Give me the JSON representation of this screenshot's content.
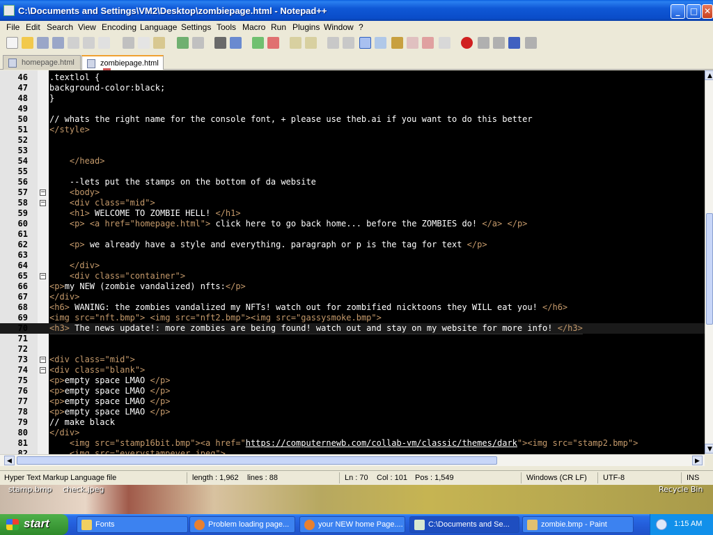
{
  "window": {
    "title": "C:\\Documents and Settings\\VM2\\Desktop\\zombiepage.html - Notepad++",
    "minimize": "_",
    "maximize": "□",
    "close": "✕"
  },
  "menu": [
    "File",
    "Edit",
    "Search",
    "View",
    "Encoding",
    "Language",
    "Settings",
    "Tools",
    "Macro",
    "Run",
    "Plugins",
    "Window",
    "?"
  ],
  "tabs": [
    {
      "label": "homepage.html",
      "active": false
    },
    {
      "label": "zombiepage.html",
      "active": true
    }
  ],
  "editor": {
    "current_line": 70,
    "lines": [
      {
        "n": "46",
        "text": ".textlol {"
      },
      {
        "n": "47",
        "text": "background-color:black;"
      },
      {
        "n": "48",
        "text": "}"
      },
      {
        "n": "49",
        "text": ""
      },
      {
        "n": "50",
        "text": "// whats the right name for the console font, + please use theb.ai if you want to do this better"
      },
      {
        "n": "51",
        "text": "</style>"
      },
      {
        "n": "52",
        "text": ""
      },
      {
        "n": "53",
        "text": ""
      },
      {
        "n": "54",
        "text": "    </head>"
      },
      {
        "n": "55",
        "text": ""
      },
      {
        "n": "56",
        "text": "    --lets put the stamps on the bottom of da website"
      },
      {
        "n": "57",
        "text": "    <body>"
      },
      {
        "n": "58",
        "text": "    <div class=\"mid\">"
      },
      {
        "n": "59",
        "text": "    <h1> WELCOME TO ZOMBIE HELL! </h1>"
      },
      {
        "n": "60",
        "text": "    <p> <a href=\"homepage.html\"> click here to go back home... before the ZOMBIES do! </a> </p>"
      },
      {
        "n": "61",
        "text": ""
      },
      {
        "n": "62",
        "text": "    <p> we already have a style and everything. paragraph or p is the tag for text </p>"
      },
      {
        "n": "63",
        "text": ""
      },
      {
        "n": "64",
        "text": "    </div>"
      },
      {
        "n": "65",
        "text": "    <div class=\"container\">"
      },
      {
        "n": "66",
        "text": "<p>my NEW (zombie vandalized) nfts:</p>"
      },
      {
        "n": "67",
        "text": "</div>"
      },
      {
        "n": "68",
        "text": "<h6> WANING: the zombies vandalized my NFTs! watch out for zombified nicktoons they WILL eat you! </h6>"
      },
      {
        "n": "69",
        "text": "<img src=\"nft.bmp\"> <img src=\"nft2.bmp\"><img src=\"gassysmoke.bmp\">"
      },
      {
        "n": "70",
        "text": "<h3> The news update!: more zombies are being found! watch out and stay on my website for more info! </h3>"
      },
      {
        "n": "71",
        "text": ""
      },
      {
        "n": "72",
        "text": ""
      },
      {
        "n": "73",
        "text": "<div class=\"mid\">"
      },
      {
        "n": "74",
        "text": "<div class=\"blank\">"
      },
      {
        "n": "75",
        "text": "<p>empty space LMAO </p>"
      },
      {
        "n": "76",
        "text": "<p>empty space LMAO </p>"
      },
      {
        "n": "77",
        "text": "<p>empty space LMAO </p>"
      },
      {
        "n": "78",
        "text": "<p>empty space LMAO </p>"
      },
      {
        "n": "79",
        "text": "// make black"
      },
      {
        "n": "80",
        "text": "</div>"
      },
      {
        "n": "81",
        "text": "    <img src=\"stamp16bit.bmp\"><a href=\"https://computernewb.com/collab-vm/classic/themes/dark\"><img src=\"stamp2.bmp\">"
      },
      {
        "n": "82",
        "text": "    <img src=\"everystampever.jpeg\">"
      }
    ],
    "fold_markers": [
      "57",
      "58",
      "65",
      "73",
      "74"
    ]
  },
  "status": {
    "file_type": "Hyper Text Markup Language file",
    "length": "length : 1,962",
    "lines": "lines : 88",
    "ln": "Ln : 70",
    "col": "Col : 101",
    "pos": "Pos : 1,549",
    "eol": "Windows (CR LF)",
    "encoding": "UTF-8",
    "mode": "INS"
  },
  "desktop": {
    "icon1": "stamp.bmp",
    "icon2": "check.jpeg",
    "icon3": "Recycle Bin"
  },
  "taskbar": {
    "start": "start",
    "tasks": [
      {
        "label": "Fonts",
        "active": false
      },
      {
        "label": "Problem loading page...",
        "active": false
      },
      {
        "label": "your NEW home Page....",
        "active": false
      },
      {
        "label": "C:\\Documents and Se...",
        "active": true
      },
      {
        "label": "zombie.bmp - Paint",
        "active": false
      }
    ],
    "clock": "1:15 AM"
  },
  "colors": {
    "tag": "#c59a6b",
    "editor_bg": "#000000",
    "text": "#ffffff",
    "accent": "#0a4cc8"
  }
}
